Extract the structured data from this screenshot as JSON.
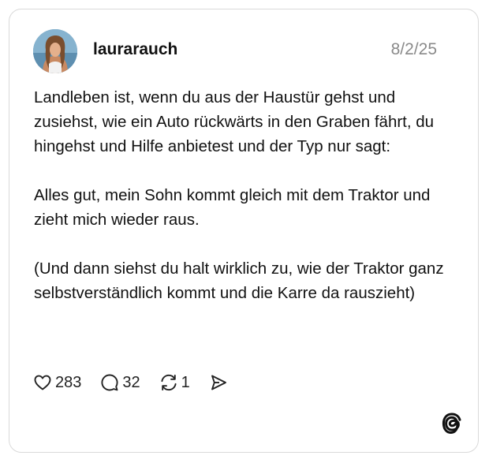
{
  "post": {
    "username": "laurarauch",
    "date": "8/2/25",
    "paragraphs": [
      "Landleben ist, wenn du aus der Haustür gehst und zusiehst, wie ein Auto rückwärts in den Graben fährt, du hingehst und Hilfe anbietest und der Typ nur sagt:",
      "Alles gut, mein Sohn kommt gleich mit dem Traktor und zieht mich wieder raus.",
      "(Und dann siehst du halt wirklich zu, wie der Traktor ganz selbstverständlich kommt und die Karre da rauszieht)"
    ]
  },
  "actions": {
    "likes": "283",
    "replies": "32",
    "reposts": "1"
  },
  "icons": {
    "like": "heart-icon",
    "reply": "speech-bubble-icon",
    "repost": "repost-arrows-icon",
    "share": "send-icon",
    "brand": "threads-logo-icon"
  }
}
